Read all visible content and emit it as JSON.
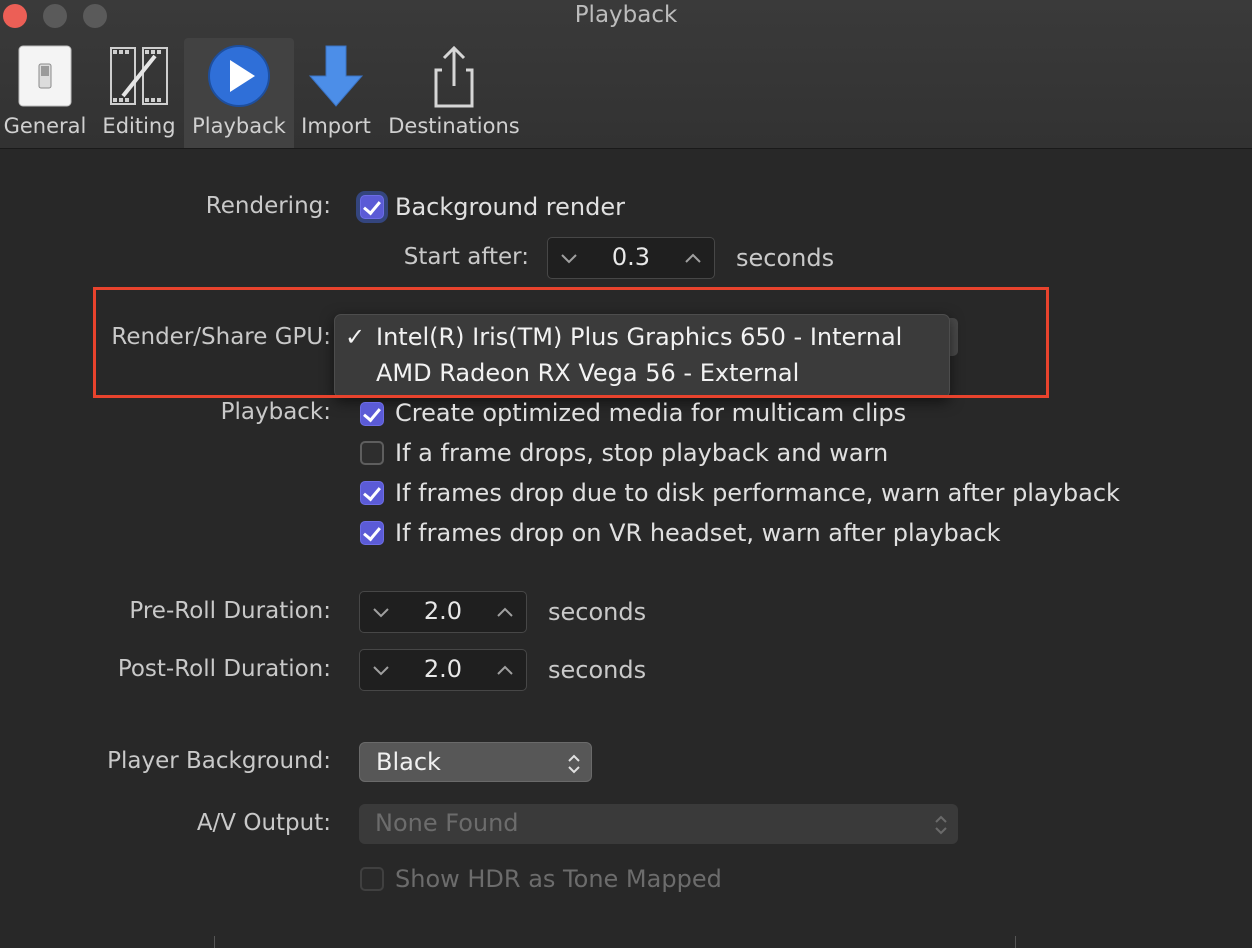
{
  "window": {
    "title": "Playback"
  },
  "toolbar": {
    "items": [
      {
        "label": "General"
      },
      {
        "label": "Editing"
      },
      {
        "label": "Playback"
      },
      {
        "label": "Import"
      },
      {
        "label": "Destinations"
      }
    ],
    "selected": "Playback"
  },
  "rendering": {
    "label": "Rendering:",
    "background_render": {
      "label": "Background render",
      "checked": true
    },
    "start_after": {
      "label": "Start after:",
      "value": "0.3",
      "unit": "seconds"
    }
  },
  "gpu": {
    "label": "Render/Share GPU:",
    "menu": [
      {
        "label": "Intel(R) Iris(TM) Plus Graphics 650 - Internal",
        "checked": true,
        "check": "✓"
      },
      {
        "label": "AMD Radeon RX Vega 56 - External",
        "checked": false
      }
    ]
  },
  "playback": {
    "label": "Playback:",
    "options": [
      {
        "label": "Create optimized media for multicam clips",
        "checked": true
      },
      {
        "label": "If a frame drops, stop playback and warn",
        "checked": false
      },
      {
        "label": "If frames drop due to disk performance, warn after playback",
        "checked": true
      },
      {
        "label": "If frames drop on VR headset, warn after playback",
        "checked": true
      }
    ]
  },
  "pre_roll": {
    "label": "Pre-Roll Duration:",
    "value": "2.0",
    "unit": "seconds"
  },
  "post_roll": {
    "label": "Post-Roll Duration:",
    "value": "2.0",
    "unit": "seconds"
  },
  "player_background": {
    "label": "Player Background:",
    "value": "Black"
  },
  "av_output": {
    "label": "A/V Output:",
    "value": "None Found",
    "enabled": false
  },
  "hdr": {
    "label": "Show HDR as Tone Mapped",
    "checked": false,
    "enabled": false
  },
  "colors": {
    "accent": "#5b5bd6",
    "highlight_border": "#e8432d",
    "background": "#282828"
  }
}
